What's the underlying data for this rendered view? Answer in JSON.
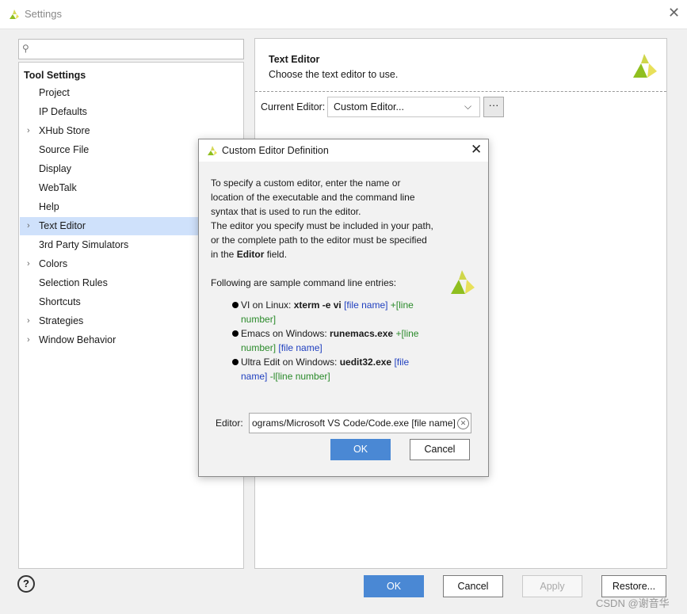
{
  "window": {
    "title": "Settings",
    "close": "✕"
  },
  "search": {
    "placeholder": "",
    "value": ""
  },
  "tree": {
    "heading": "Tool Settings",
    "items": [
      {
        "label": "Project",
        "arrow": ""
      },
      {
        "label": "IP Defaults",
        "arrow": ""
      },
      {
        "label": "XHub Store",
        "arrow": "›"
      },
      {
        "label": "Source File",
        "arrow": ""
      },
      {
        "label": "Display",
        "arrow": ""
      },
      {
        "label": "WebTalk",
        "arrow": ""
      },
      {
        "label": "Help",
        "arrow": ""
      },
      {
        "label": "Text Editor",
        "arrow": "›",
        "selected": true
      },
      {
        "label": "3rd Party Simulators",
        "arrow": ""
      },
      {
        "label": "Colors",
        "arrow": "›"
      },
      {
        "label": "Selection Rules",
        "arrow": ""
      },
      {
        "label": "Shortcuts",
        "arrow": ""
      },
      {
        "label": "Strategies",
        "arrow": "›"
      },
      {
        "label": "Window Behavior",
        "arrow": "›"
      }
    ]
  },
  "panel": {
    "title": "Text Editor",
    "description": "Choose the text editor to use.",
    "current_editor_label": "Current Editor:",
    "current_editor_value": "Custom Editor...",
    "browse_label": "···"
  },
  "dialog": {
    "title": "Custom Editor Definition",
    "close": "✕",
    "intro_lines": [
      "To specify a custom editor, enter the name or",
      "location of the executable and the command line",
      "syntax that is used to run the editor.",
      "The editor you specify must be included in your path,",
      "or the complete path to the editor must be specified"
    ],
    "intro_last": {
      "prefix": "in the ",
      "bold": "Editor",
      "suffix": " field."
    },
    "samples_heading": "Following are sample command line entries:",
    "samples": [
      {
        "prefix": "VI on Linux: ",
        "command": "xterm -e vi",
        "placeholder": "[file name]",
        "extra": "+[line",
        "extra2": "number]",
        "placeholder2": ""
      },
      {
        "prefix": "Emacs on Windows: ",
        "command": "runemacs.exe",
        "placeholder": "",
        "extra": "+[line",
        "extra2": "number]",
        "placeholder2": "[file name]"
      },
      {
        "prefix": "Ultra Edit on Windows: ",
        "command": "uedit32.exe",
        "placeholder": "[file",
        "extra": "",
        "extra2": "name]",
        "placeholder2": "-l[line number]"
      }
    ],
    "editor_label": "Editor:",
    "editor_value": "ograms/Microsoft VS Code/Code.exe [file name]",
    "ok_label": "OK",
    "cancel_label": "Cancel"
  },
  "footer": {
    "help_label": "?",
    "ok_label": "OK",
    "cancel_label": "Cancel",
    "apply_label": "Apply",
    "restore_label": "Restore..."
  },
  "watermark": "CSDN @谢音华",
  "colors": {
    "accent": "#4a88d4",
    "selection": "#cfe1fb",
    "logo_green": "#8fbf1f",
    "logo_yellow": "#e8e05a"
  }
}
